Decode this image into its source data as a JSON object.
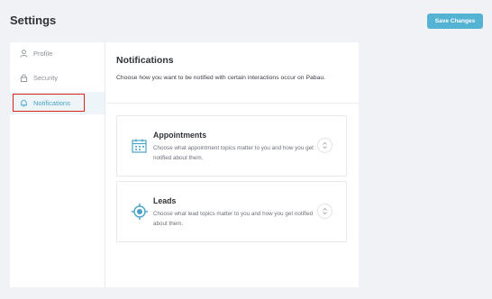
{
  "header": {
    "title": "Settings",
    "save_label": "Save Changes"
  },
  "sidebar": {
    "items": [
      {
        "label": "Profile",
        "icon": "user-icon",
        "active": false
      },
      {
        "label": "Security",
        "icon": "lock-icon",
        "active": false
      },
      {
        "label": "Notifications",
        "icon": "bell-icon",
        "active": true
      }
    ]
  },
  "main": {
    "title": "Notifications",
    "description": "Choose how you want to be notified with certain interactions occur on Pabau.",
    "cards": [
      {
        "title": "Appointments",
        "description": "Choose what appointment topics matter to you and how you get notified about them.",
        "icon": "calendar-icon"
      },
      {
        "title": "Leads",
        "description": "Choose what lead topics matter to you and how you get notified about them.",
        "icon": "target-icon"
      }
    ]
  },
  "colors": {
    "accent": "#54b2d3",
    "background": "#f1f2f6",
    "highlight": "#e0201b"
  }
}
